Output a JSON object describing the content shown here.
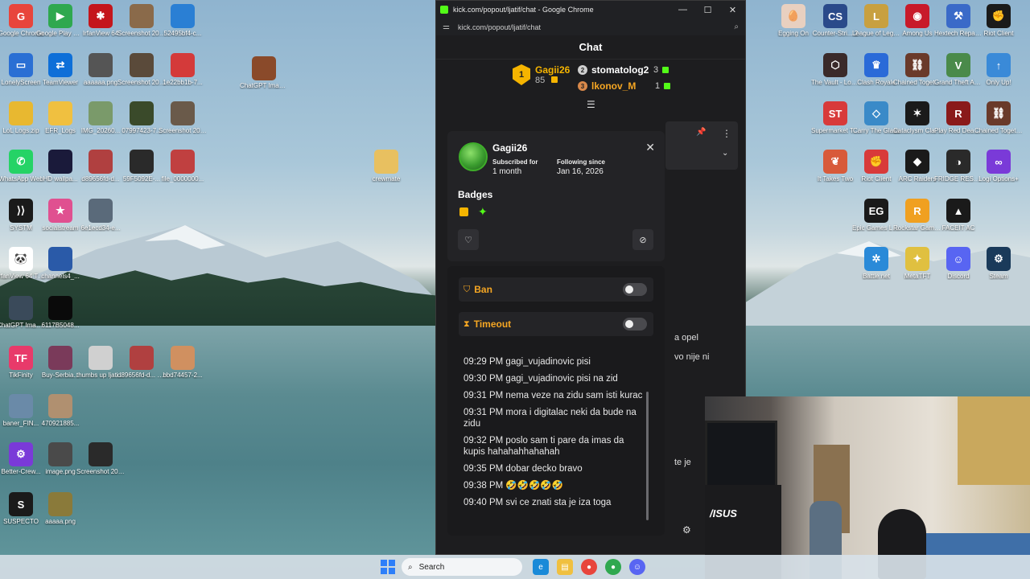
{
  "window": {
    "title": "kick.com/popout/ljatif/chat - Google Chrome",
    "url": "kick.com/popout/ljatif/chat"
  },
  "chat": {
    "header": "Chat",
    "leaderboard": {
      "first": {
        "rank": "1",
        "name": "Gagii26",
        "count": "85"
      },
      "second": {
        "rank": "2",
        "name": "stomatolog2",
        "count": "3"
      },
      "third": {
        "rank": "3",
        "name": "lkonov_M",
        "count": "1"
      }
    },
    "background_snippets": [
      "a opel",
      "vo nije ni",
      "te je"
    ]
  },
  "user_card": {
    "username": "Gagii26",
    "subscribed_label": "Subscribed for",
    "subscribed_value": "1 month",
    "following_label": "Following since",
    "following_value": "Jan 16, 2026",
    "badges_title": "Badges"
  },
  "moderation": {
    "ban_label": "Ban",
    "timeout_label": "Timeout"
  },
  "messages": [
    "09:29 PM gagi_vujadinovic pisi",
    "09:30 PM gagi_vujadinovic pisi na zid",
    "09:31 PM nema veze na zidu sam isti kurac",
    "09:31 PM mora i digitalac neki da bude na zidu",
    "09:32 PM poslo sam ti pare da imas da kupis hahahahhahahah",
    "09:35 PM dobar decko bravo",
    "09:38 PM 🤣🤣🤣🤣🤣",
    "09:40 PM svi ce znati sta je iza toga"
  ],
  "desktop_left": [
    {
      "label": "Google Chrome",
      "color": "#e8453c",
      "glyph": "G"
    },
    {
      "label": "Google Play Games",
      "color": "#2fa84f",
      "glyph": "▶"
    },
    {
      "label": "IrfanView 64",
      "color": "#c4161c",
      "glyph": "✱"
    },
    {
      "label": "Screenshot 2026-01-...",
      "color": "#8a6a4a",
      "glyph": ""
    },
    {
      "label": "52495bf4-c...",
      "color": "#2a7fd4",
      "glyph": ""
    },
    {
      "label": "LonelyScreen",
      "color": "#2a6fd4",
      "glyph": "▭"
    },
    {
      "label": "TeamViewer",
      "color": "#0e6fd8",
      "glyph": "⇄"
    },
    {
      "label": "aaaaaa.png",
      "color": "#555",
      "glyph": ""
    },
    {
      "label": "Screenshot 2026-01-...",
      "color": "#5a4a3a",
      "glyph": ""
    },
    {
      "label": "1e22bb1b-7...",
      "color": "#d43a3a",
      "glyph": ""
    },
    {
      "label": "LoL Logs.zip",
      "color": "#e8b830",
      "glyph": ""
    },
    {
      "label": "EFR_Logs",
      "color": "#f0c040",
      "glyph": ""
    },
    {
      "label": "IMG_20260...",
      "color": "#7a9a6a",
      "glyph": ""
    },
    {
      "label": "07997423-7...",
      "color": "#3a4a2a",
      "glyph": ""
    },
    {
      "label": "Screenshot 2026-01-...",
      "color": "#6a5a4a",
      "glyph": ""
    },
    {
      "label": "WhatsApp Web",
      "color": "#25d366",
      "glyph": "✆"
    },
    {
      "label": "HD wallpa...",
      "color": "#1a1a3a",
      "glyph": ""
    },
    {
      "label": "d89656fd-d...",
      "color": "#b04040",
      "glyph": ""
    },
    {
      "label": "59F5092E-...",
      "color": "#2a2a2a",
      "glyph": ""
    },
    {
      "label": "file_0000000...",
      "color": "#c04040",
      "glyph": ""
    },
    {
      "label": "SYSTM",
      "color": "#1a1a1a",
      "glyph": "⟩⟩"
    },
    {
      "label": "socialstream",
      "color": "#e05090",
      "glyph": "★"
    },
    {
      "label": "6e1ecd34-e...",
      "color": "#5a6a7a",
      "glyph": ""
    },
    {
      "label": "IrfanView 64 Thumbnails",
      "color": "#ffffff",
      "glyph": "🐼"
    },
    {
      "label": "channels4_...",
      "color": "#2a5aa8",
      "glyph": ""
    },
    {
      "label": "ChatGPT Image Sep...",
      "color": "#3a4a5a",
      "glyph": ""
    },
    {
      "label": "6117B5048...",
      "color": "#0a0a0a",
      "glyph": ""
    },
    {
      "label": "TikFinity",
      "color": "#e83a6a",
      "glyph": "TF"
    },
    {
      "label": "Buy-Serbia...",
      "color": "#7a3a5a",
      "glyph": ""
    },
    {
      "label": "thumbs up ljatif.jpg",
      "color": "#d0d0d0",
      "glyph": ""
    },
    {
      "label": "d89656fd-d... (1).webp",
      "color": "#b04040",
      "glyph": ""
    },
    {
      "label": "bbd74457-2...",
      "color": "#d09060",
      "glyph": ""
    },
    {
      "label": "baner_FIN...",
      "color": "#6a8aa8",
      "glyph": ""
    },
    {
      "label": "470921885...",
      "color": "#b09070",
      "glyph": ""
    },
    {
      "label": "Better-Crew...",
      "color": "#7a3ad8",
      "glyph": "⚙"
    },
    {
      "label": "image.png",
      "color": "#4a4a4a",
      "glyph": ""
    },
    {
      "label": "Screenshot 2026-01-...",
      "color": "#2a2a2a",
      "glyph": ""
    },
    {
      "label": "SUSPECTO",
      "color": "#1a1a1a",
      "glyph": "S"
    },
    {
      "label": "aaaaa.png",
      "color": "#8a7a3a",
      "glyph": ""
    },
    {
      "label": "ChatGPT Image Jan...",
      "color": "#8a4a2a",
      "glyph": ""
    },
    {
      "label": "crewmate",
      "color": "#e8c060",
      "glyph": ""
    }
  ],
  "desktop_right": [
    {
      "label": "Egging On",
      "color": "#e8d0c0",
      "glyph": "🥚"
    },
    {
      "label": "Counter-Stri... 2",
      "color": "#2a4a8a",
      "glyph": "CS"
    },
    {
      "label": "League of Legends",
      "color": "#c8a040",
      "glyph": "L"
    },
    {
      "label": "Among Us",
      "color": "#c81a2a",
      "glyph": "◉"
    },
    {
      "label": "Hextech Repair Tool",
      "color": "#3a6ac8",
      "glyph": "⚒"
    },
    {
      "label": "Riot Client",
      "color": "#1a1a1a",
      "glyph": "✊"
    },
    {
      "label": "The Vault - Logic Puzz...",
      "color": "#3a2a2a",
      "glyph": "⬡"
    },
    {
      "label": "Clash Royale",
      "color": "#2a6ad8",
      "glyph": "♛"
    },
    {
      "label": "Chained Together",
      "color": "#6a3a2a",
      "glyph": "⛓"
    },
    {
      "label": "Grand Theft Auto V",
      "color": "#4a8a4a",
      "glyph": "V"
    },
    {
      "label": "Only Up!",
      "color": "#3a8ad8",
      "glyph": "↑"
    },
    {
      "label": "Supermarket Together",
      "color": "#d83a3a",
      "glyph": "ST"
    },
    {
      "label": "Carry The Glass",
      "color": "#3a8ac8",
      "glyph": "◇"
    },
    {
      "label": "Cataclysm Classic",
      "color": "#1a1a1a",
      "glyph": "✶"
    },
    {
      "label": "Play Red Dead Rede...",
      "color": "#8a1a1a",
      "glyph": "R"
    },
    {
      "label": "Chained Together",
      "color": "#6a3a2a",
      "glyph": "⛓"
    },
    {
      "label": "It Takes Two",
      "color": "#d85a3a",
      "glyph": "❦"
    },
    {
      "label": "Riot Client",
      "color": "#d83a3a",
      "glyph": "✊"
    },
    {
      "label": "ARC Raiders",
      "color": "#1a1a1a",
      "glyph": "◆"
    },
    {
      "label": "FRIDGE RESET STREMIO (1)",
      "color": "#2a2a2a",
      "glyph": "◑"
    },
    {
      "label": "Logi Options+",
      "color": "#7a3ad8",
      "glyph": "∞"
    },
    {
      "label": "Epic Games Launcher",
      "color": "#1a1a1a",
      "glyph": "EG"
    },
    {
      "label": "Rockstar Games ...",
      "color": "#f0a020",
      "glyph": "R"
    },
    {
      "label": "FACEIT AC",
      "color": "#1a1a1a",
      "glyph": "▲"
    },
    {
      "label": "Battle.net",
      "color": "#2a8ad8",
      "glyph": "✲"
    },
    {
      "label": "MetaTFT",
      "color": "#e0c040",
      "glyph": "✦"
    },
    {
      "label": "Discord",
      "color": "#5865f2",
      "glyph": "☺"
    },
    {
      "label": "Steam",
      "color": "#1a3a5a",
      "glyph": "⚙"
    }
  ],
  "taskbar": {
    "search_placeholder": "Search"
  },
  "colors": {
    "kick_green": "#53fc18",
    "gold": "#f5b400",
    "mod_orange": "#f5a623"
  }
}
